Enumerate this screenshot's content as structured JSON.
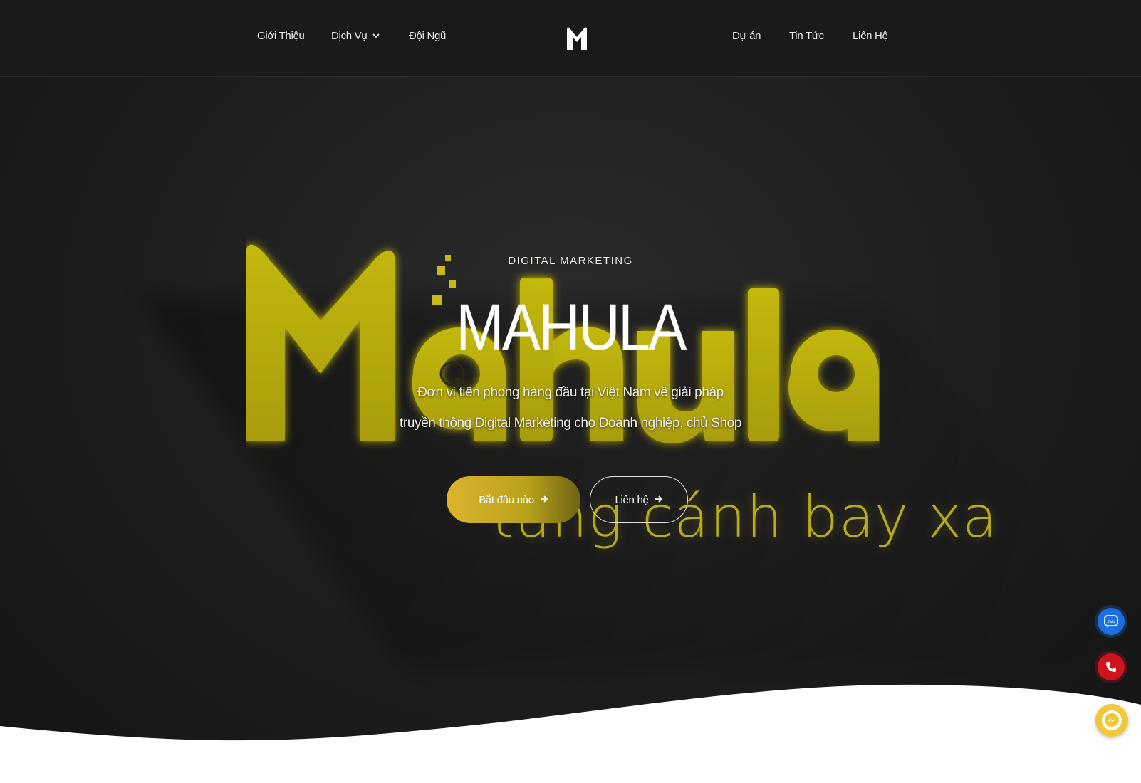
{
  "nav": {
    "left": [
      {
        "label": "Giới Thiệu"
      },
      {
        "label": "Dịch Vụ",
        "has_dropdown": true
      },
      {
        "label": "Đội Ngũ"
      }
    ],
    "right": [
      {
        "label": "Dự án"
      },
      {
        "label": "Tin Tức"
      },
      {
        "label": "Liên Hệ"
      }
    ]
  },
  "hero": {
    "background_word": "Mahula",
    "background_tagline": "tung cánh bay xa",
    "eyebrow": "DIGITAL MARKETING",
    "headline": "MAHULA",
    "subtitle_line1": "Đơn vị tiên phong hàng đầu tại Việt Nam về giải pháp",
    "subtitle_line2": "truyền thông Digital Marketing cho Doanh nghiệp, chủ Shop",
    "primary_button": "Bắt đầu nào",
    "secondary_button": "Liên hệ"
  },
  "floating": {
    "zalo_label": "Zalo"
  },
  "colors": {
    "background": "#1d1d1e",
    "accent_yellow": "#c8be12",
    "button_gold": "#dcb42d",
    "zalo_blue": "#1c6fe0",
    "phone_red": "#d0141c",
    "messenger_yellow": "#f0c93a"
  }
}
